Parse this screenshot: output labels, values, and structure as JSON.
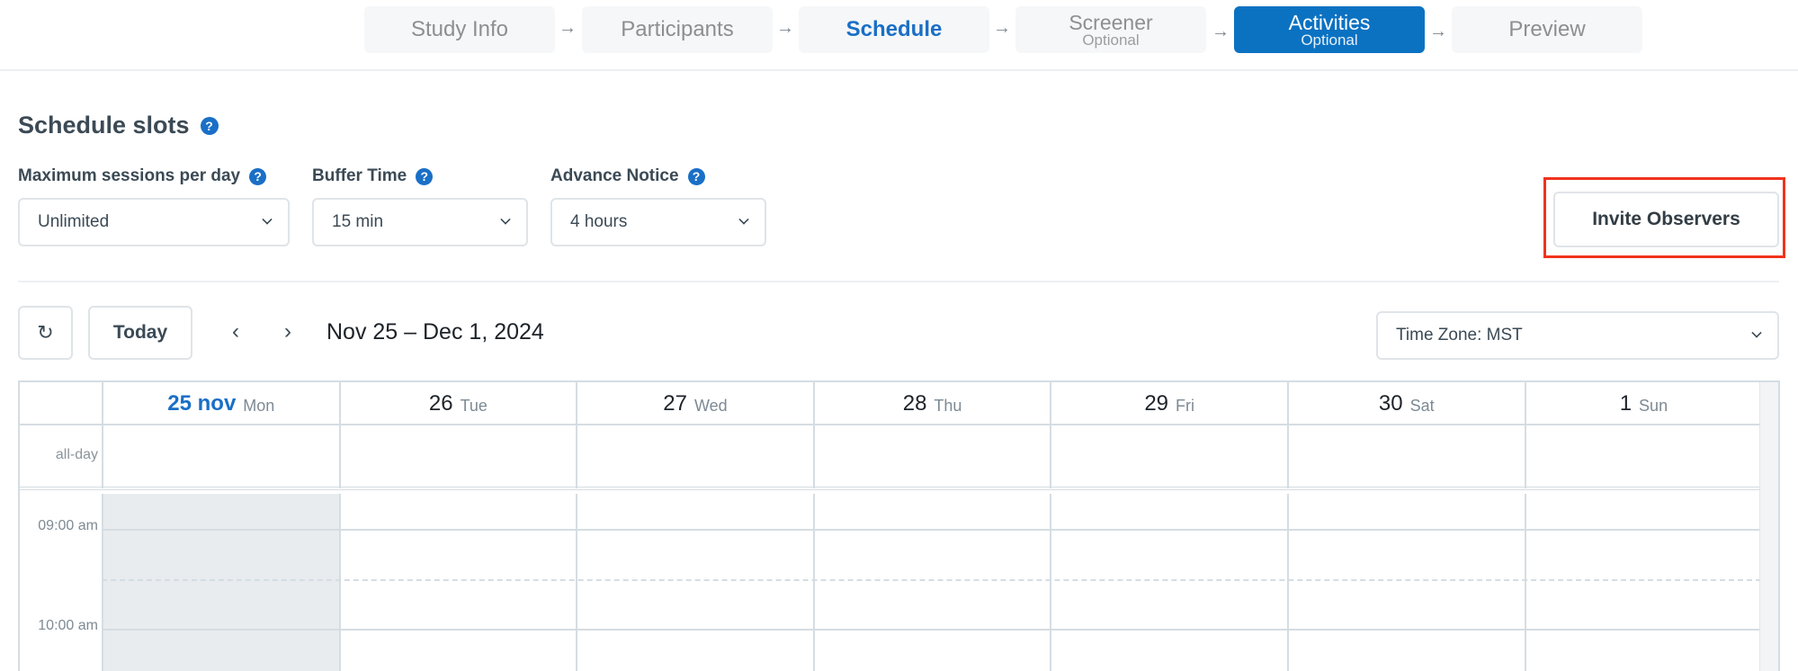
{
  "stepper": {
    "steps": [
      {
        "label": "Study Info",
        "sub": "",
        "state": "default"
      },
      {
        "label": "Participants",
        "sub": "",
        "state": "default"
      },
      {
        "label": "Schedule",
        "sub": "",
        "state": "current"
      },
      {
        "label": "Screener",
        "sub": "Optional",
        "state": "default"
      },
      {
        "label": "Activities",
        "sub": "Optional",
        "state": "active"
      },
      {
        "label": "Preview",
        "sub": "",
        "state": "default"
      }
    ],
    "arrow_glyph": "→"
  },
  "schedule": {
    "title": "Schedule slots",
    "help_glyph": "?",
    "fields": {
      "max_sessions": {
        "label": "Maximum sessions per day",
        "value": "Unlimited"
      },
      "buffer_time": {
        "label": "Buffer Time",
        "value": "15 min"
      },
      "advance_notice": {
        "label": "Advance Notice",
        "value": "4 hours"
      }
    },
    "invite_button": "Invite Observers",
    "highlight_color": "#f0331c"
  },
  "toolbar": {
    "refresh_glyph": "↻",
    "today_label": "Today",
    "prev_glyph": "‹",
    "next_glyph": "›",
    "date_range": "Nov 25 – Dec 1, 2024",
    "timezone": "Time Zone: MST"
  },
  "calendar": {
    "allday_label": "all-day",
    "days": [
      {
        "num": "25 nov",
        "name": "Mon",
        "today": true
      },
      {
        "num": "26",
        "name": "Tue",
        "today": false
      },
      {
        "num": "27",
        "name": "Wed",
        "today": false
      },
      {
        "num": "28",
        "name": "Thu",
        "today": false
      },
      {
        "num": "29",
        "name": "Fri",
        "today": false
      },
      {
        "num": "30",
        "name": "Sat",
        "today": false
      },
      {
        "num": "1",
        "name": "Sun",
        "today": false
      }
    ],
    "times": [
      "09:00 am",
      "10:00 am"
    ]
  },
  "colors": {
    "accent": "#1a6fc6",
    "active_step": "#0b72c2",
    "today_column": "#e8ecef"
  }
}
